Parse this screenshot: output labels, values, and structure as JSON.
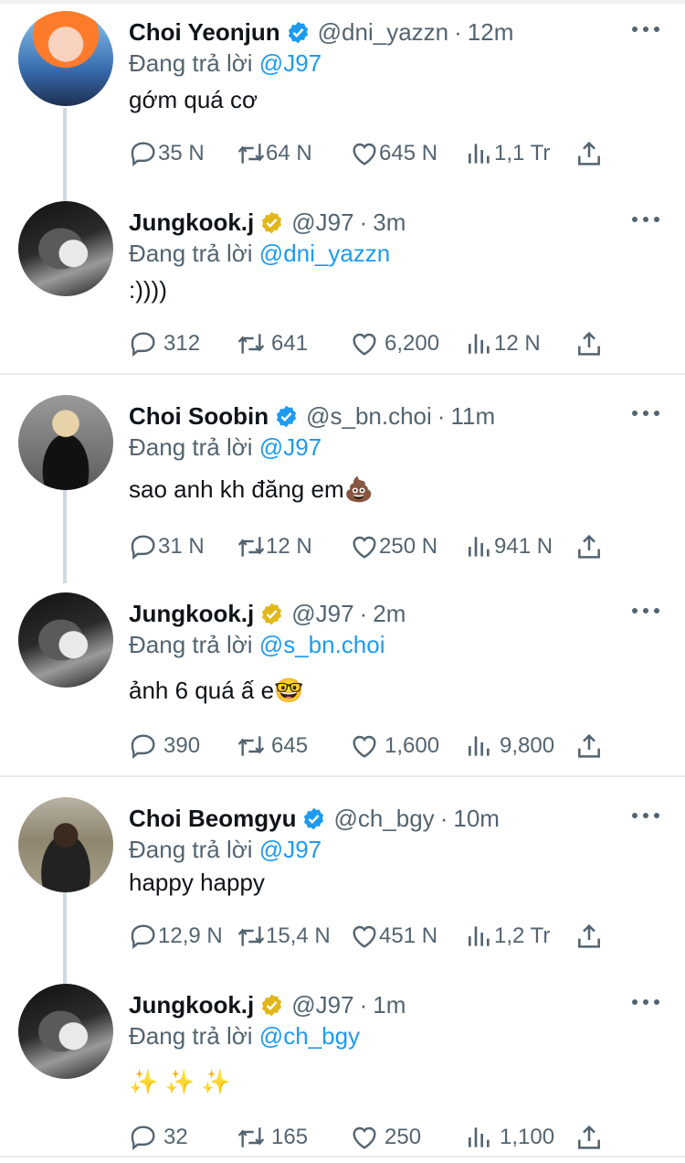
{
  "colors": {
    "accent": "#1d9bf0",
    "text": "#0f1419",
    "muted": "#536471",
    "verified_blue": "#1d9bf0",
    "verified_gold": "#e2b719"
  },
  "icons": {
    "reply": "speech-bubble-icon",
    "retweet": "retweet-icon",
    "like": "heart-icon",
    "views": "bar-chart-icon",
    "share": "share-upload-icon",
    "more": "more-dots-icon"
  },
  "reply_prefix": "Đang trả lời",
  "threads": [
    {
      "tweets": [
        {
          "name": "Choi Yeonjun",
          "handle": "@dni_yazzn",
          "time": "12m",
          "badge": "blue",
          "reply_to": "@J97",
          "text": "gớm quá cơ",
          "replies": "35 N",
          "retweets": "64 N",
          "likes": "645 N",
          "views": "1,1 Tr"
        },
        {
          "name": "Jungkook.j",
          "handle": "@J97",
          "time": "3m",
          "badge": "gold",
          "reply_to": "@dni_yazzn",
          "text": ":))))",
          "replies": "312",
          "retweets": "641",
          "likes": "6,200",
          "views": "12 N"
        }
      ]
    },
    {
      "tweets": [
        {
          "name": "Choi Soobin",
          "handle": "@s_bn.choi",
          "time": "11m",
          "badge": "blue",
          "reply_to": "@J97",
          "text": "sao anh kh đăng em💩",
          "replies": "31 N",
          "retweets": "12 N",
          "likes": "250 N",
          "views": "941 N"
        },
        {
          "name": "Jungkook.j",
          "handle": "@J97",
          "time": "2m",
          "badge": "gold",
          "reply_to": "@s_bn.choi",
          "text": "ảnh 6 quá ấ e🤓",
          "replies": "390",
          "retweets": "645",
          "likes": "1,600",
          "views": "9,800"
        }
      ]
    },
    {
      "tweets": [
        {
          "name": "Choi Beomgyu",
          "handle": "@ch_bgy",
          "time": "10m",
          "badge": "blue",
          "reply_to": "@J97",
          "text": "happy happy",
          "replies": "12,9 N",
          "retweets": "15,4 N",
          "likes": "451 N",
          "views": "1,2 Tr"
        },
        {
          "name": "Jungkook.j",
          "handle": "@J97",
          "time": "1m",
          "badge": "gold",
          "reply_to": "@ch_bgy",
          "text": "✨ ✨ ✨",
          "replies": "32",
          "retweets": "165",
          "likes": "250",
          "views": "1,100"
        }
      ]
    }
  ]
}
